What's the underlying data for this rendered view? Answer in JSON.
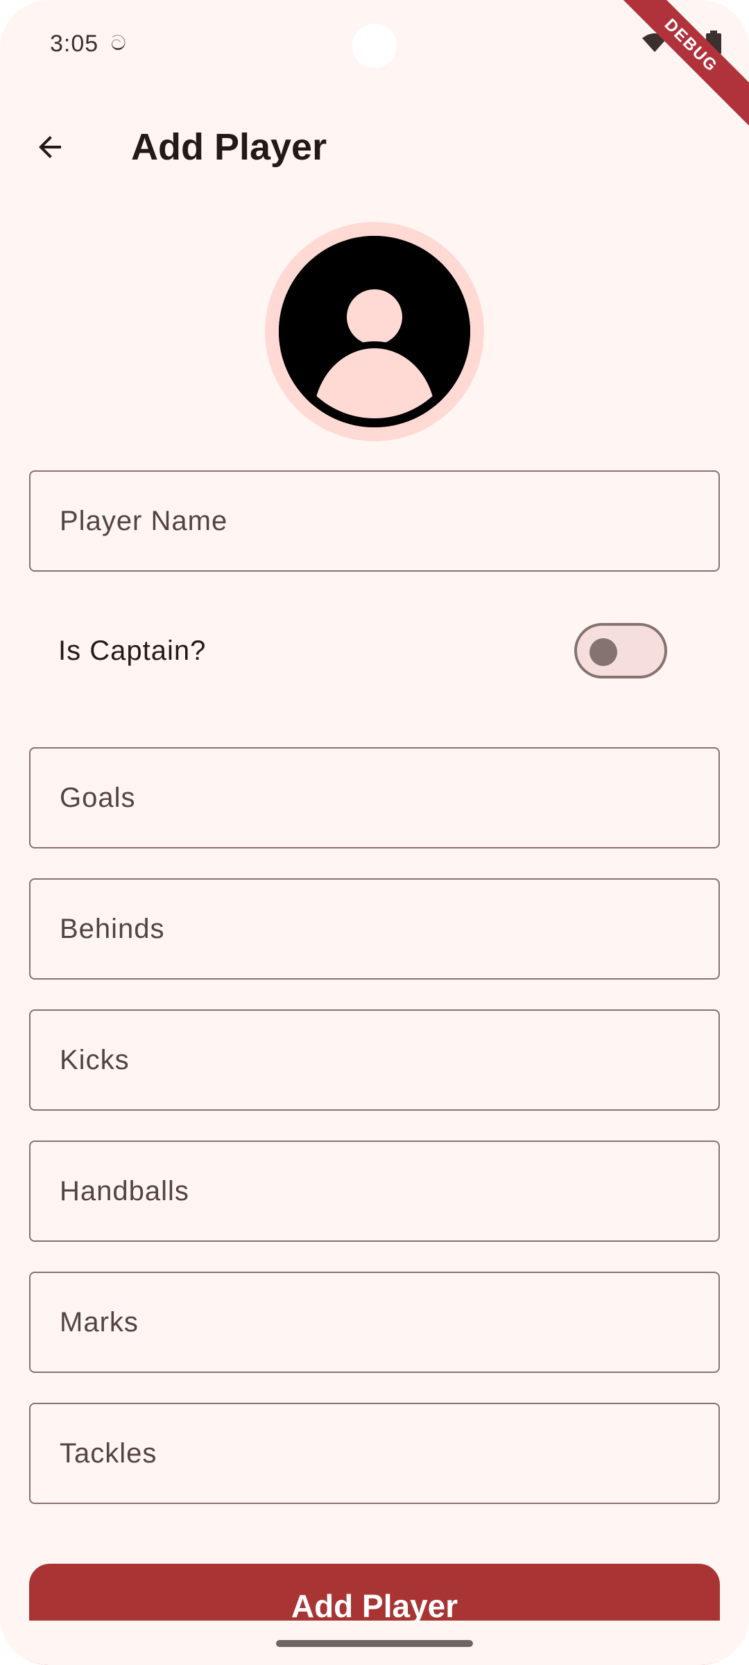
{
  "status_bar": {
    "time": "3:05",
    "notification_icon": "notification-glyph-icon",
    "icons": [
      "wifi-icon",
      "signal-icon",
      "battery-icon"
    ]
  },
  "debug_banner": "DEBUG",
  "app_bar": {
    "back_icon": "arrow-back-icon",
    "title": "Add Player"
  },
  "avatar": {
    "icon": "account-circle-icon"
  },
  "form": {
    "player_name": {
      "placeholder": "Player Name",
      "value": ""
    },
    "captain": {
      "label": "Is Captain?",
      "on": false
    },
    "goals": {
      "placeholder": "Goals",
      "value": ""
    },
    "behinds": {
      "placeholder": "Behinds",
      "value": ""
    },
    "kicks": {
      "placeholder": "Kicks",
      "value": ""
    },
    "handballs": {
      "placeholder": "Handballs",
      "value": ""
    },
    "marks": {
      "placeholder": "Marks",
      "value": ""
    },
    "tackles": {
      "placeholder": "Tackles",
      "value": ""
    }
  },
  "actions": {
    "add_label": "Add Player"
  },
  "colors": {
    "background": "#fff5f3",
    "primary": "#a83434",
    "outline": "#857370",
    "avatar_ring": "#ffdad5"
  }
}
